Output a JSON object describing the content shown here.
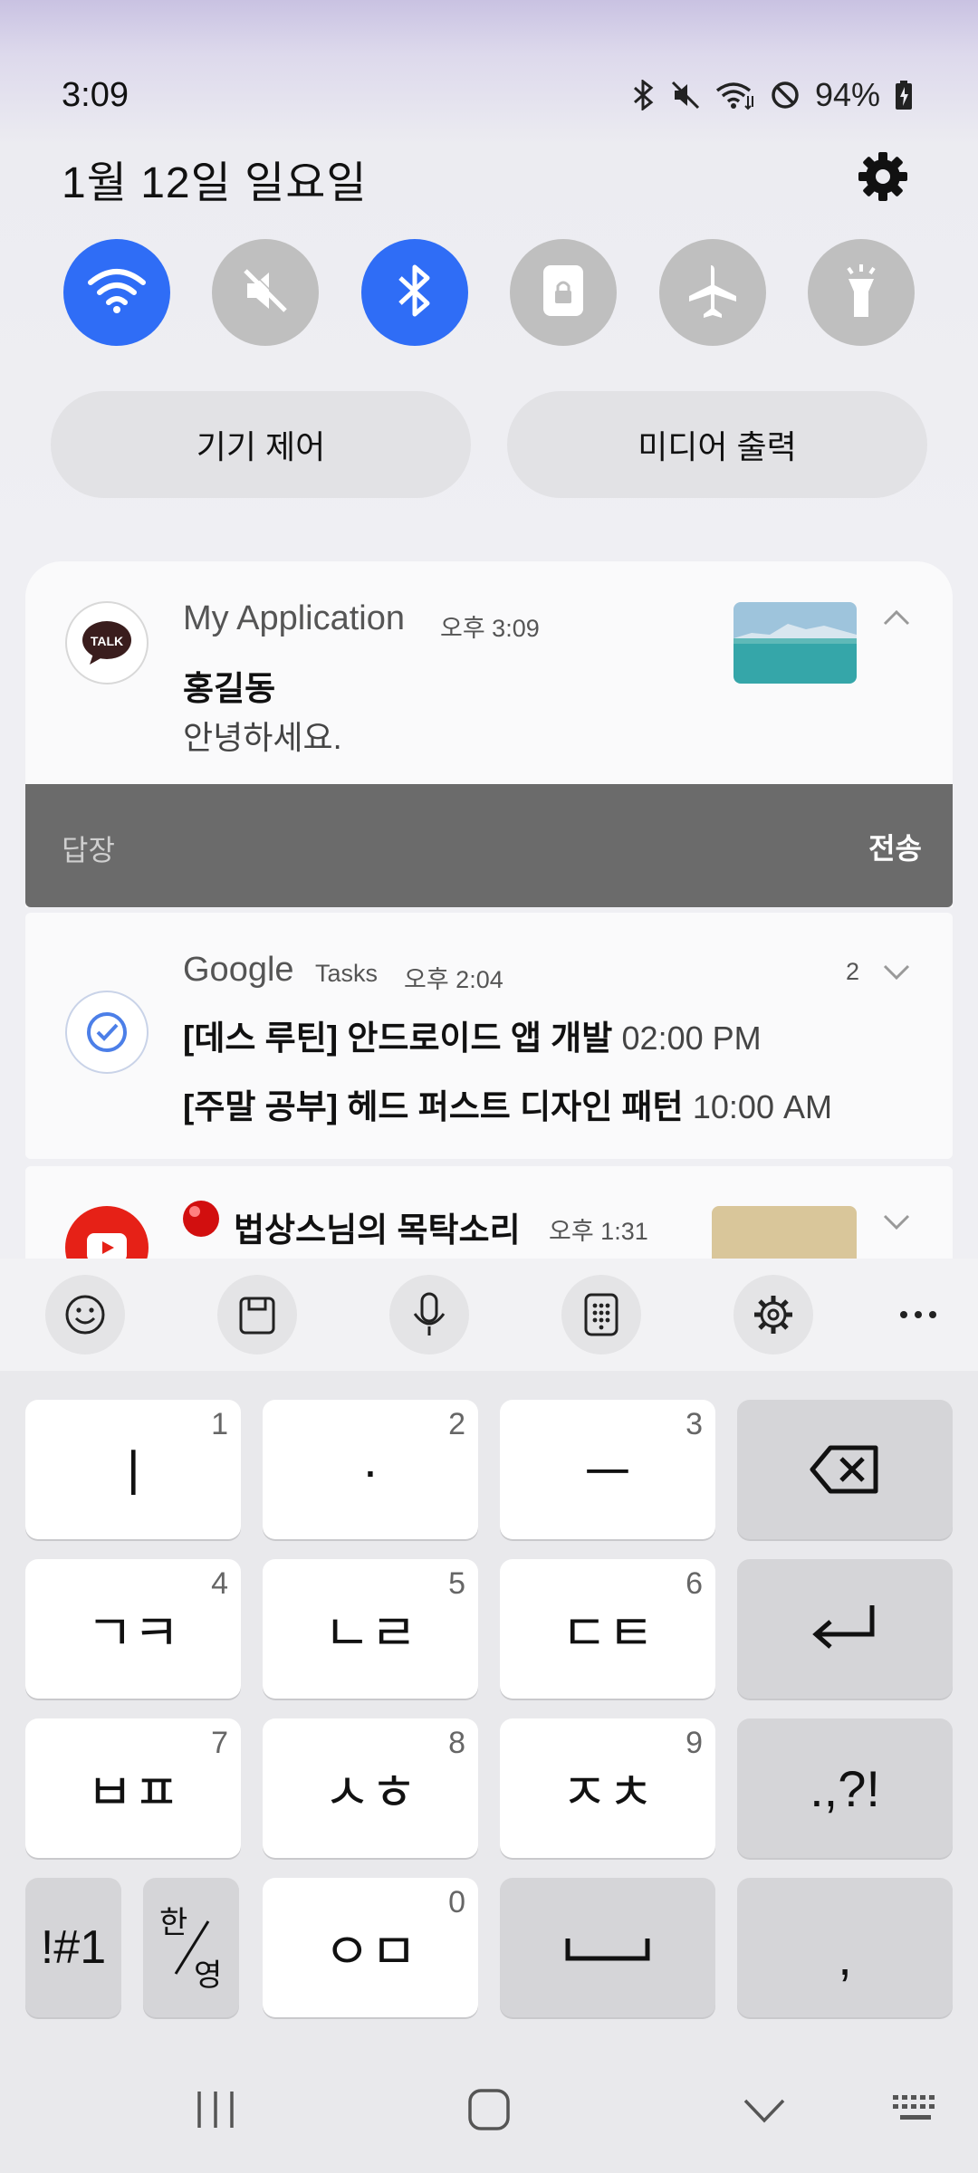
{
  "status_bar": {
    "time": "3:09",
    "battery": "94%"
  },
  "shade": {
    "date": "1월 12일 일요일",
    "settings_icon": "gear-icon",
    "toggles": [
      {
        "icon": "wifi-icon",
        "on": true
      },
      {
        "icon": "mute-icon",
        "on": false
      },
      {
        "icon": "bluetooth-icon",
        "on": true
      },
      {
        "icon": "lock-rotation-icon",
        "on": false
      },
      {
        "icon": "airplane-icon",
        "on": false
      },
      {
        "icon": "flashlight-icon",
        "on": false
      }
    ],
    "device_control": "기기 제어",
    "media_output": "미디어 출력"
  },
  "notifications": {
    "n1": {
      "app": "My Application",
      "time": "오후 3:09",
      "avatar_text": "TALK",
      "title": "홍길동",
      "text": "안녕하세요.",
      "reply_placeholder": "답장",
      "send": "전송"
    },
    "n2": {
      "app": "Google",
      "sub_app": "Tasks",
      "time": "오후 2:04",
      "count": "2",
      "task1_title": "[데스 루틴] 안드로이드 앱 개발",
      "task1_time": "02:00 PM",
      "task2_title": "[주말 공부] 헤드 퍼스트 디자인 패턴",
      "task2_time": "10:00 AM"
    },
    "n3": {
      "title": "법상스님의 목탁소리",
      "time": "오후 1:31"
    }
  },
  "keyboard": {
    "keys": [
      {
        "label": "ㅣ",
        "num": "1"
      },
      {
        "label": "·",
        "num": "2"
      },
      {
        "label": "ㅡ",
        "num": "3"
      },
      {
        "label": "ㄱㅋ",
        "num": "4"
      },
      {
        "label": "ㄴㄹ",
        "num": "5"
      },
      {
        "label": "ㄷㅌ",
        "num": "6"
      },
      {
        "label": "ㅂㅍ",
        "num": "7"
      },
      {
        "label": "ㅅㅎ",
        "num": "8"
      },
      {
        "label": "ㅈㅊ",
        "num": "9"
      },
      {
        "label": "ㅇㅁ",
        "num": "0"
      }
    ],
    "punct": ".,?!",
    "symbols": "!#1",
    "lang_top": "한",
    "lang_bottom": "영",
    "comma": ","
  },
  "colors": {
    "accent": "#2f6df6",
    "toggle_off": "#bfbfbf",
    "reply_bar": "#6b6b6b"
  }
}
